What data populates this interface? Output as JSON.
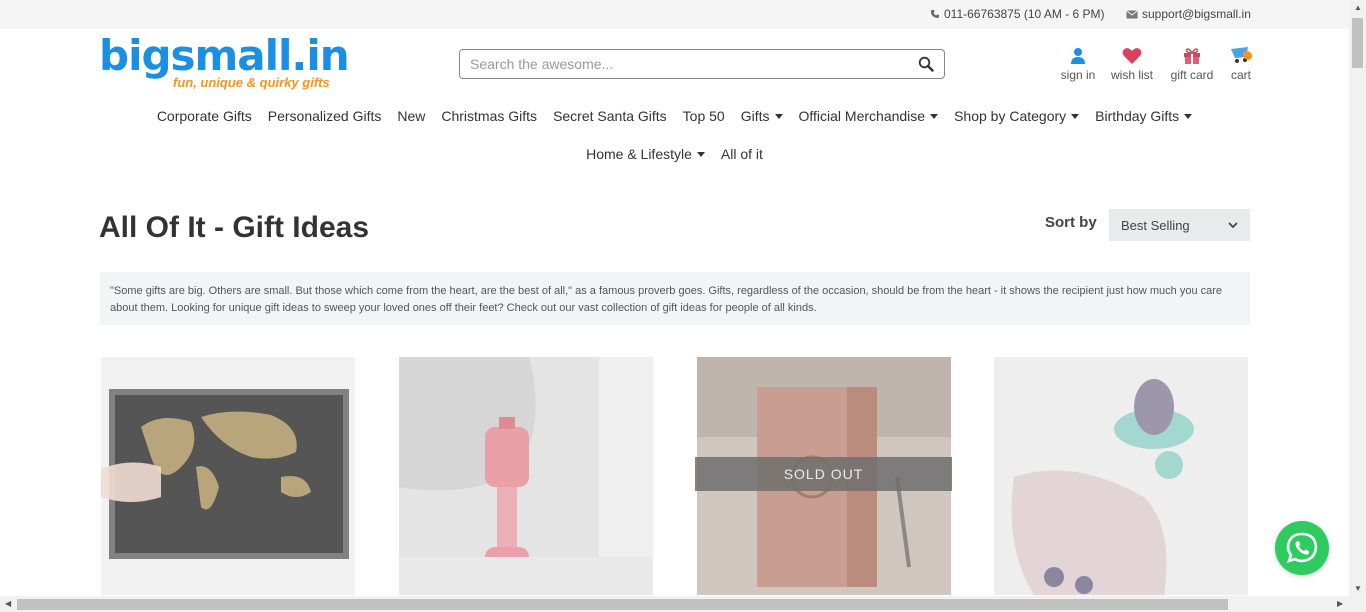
{
  "topbar": {
    "phone": "011-66763875 (10 AM - 6 PM)",
    "email": "support@bigsmall.in"
  },
  "logo": {
    "name": "bigsmall.in",
    "tagline": "fun, unique & quirky gifts"
  },
  "search": {
    "placeholder": "Search the awesome..."
  },
  "user_links": [
    {
      "label": "sign in",
      "icon": "user-icon"
    },
    {
      "label": "wish list",
      "icon": "heart-icon"
    },
    {
      "label": "gift card",
      "icon": "gift-icon"
    },
    {
      "label": "cart",
      "icon": "cart-icon"
    }
  ],
  "nav": {
    "row1": [
      {
        "label": "Corporate Gifts"
      },
      {
        "label": "Personalized Gifts"
      },
      {
        "label": "New"
      },
      {
        "label": "Christmas Gifts"
      },
      {
        "label": "Secret Santa Gifts"
      },
      {
        "label": "Top 50"
      },
      {
        "label": "Gifts"
      },
      {
        "label": "Official Merchandise"
      },
      {
        "label": "Shop by Category"
      },
      {
        "label": "Birthday Gifts"
      }
    ],
    "row2": [
      {
        "label": "Home & Lifestyle"
      },
      {
        "label": "All of it"
      }
    ]
  },
  "page": {
    "title": "All Of It - Gift Ideas",
    "sort_label": "Sort by",
    "sort_value": "Best Selling",
    "description": "\"Some gifts are big. Others are small. But those which come from the heart, are the best of all,\" as a famous proverb goes. Gifts, regardless of the occasion, should be from the heart - it shows the recipient just how much you care about them. Looking for unique gift ideas to sweep your loved ones off their feet? Check out our vast collection of gift ideas for people of all kinds."
  },
  "products": {
    "sold_out_label": "SOLD OUT"
  },
  "colors": {
    "brand_blue": "#1a8fe3",
    "brand_orange": "#f7941d",
    "whatsapp_green": "#2ecc5f"
  }
}
